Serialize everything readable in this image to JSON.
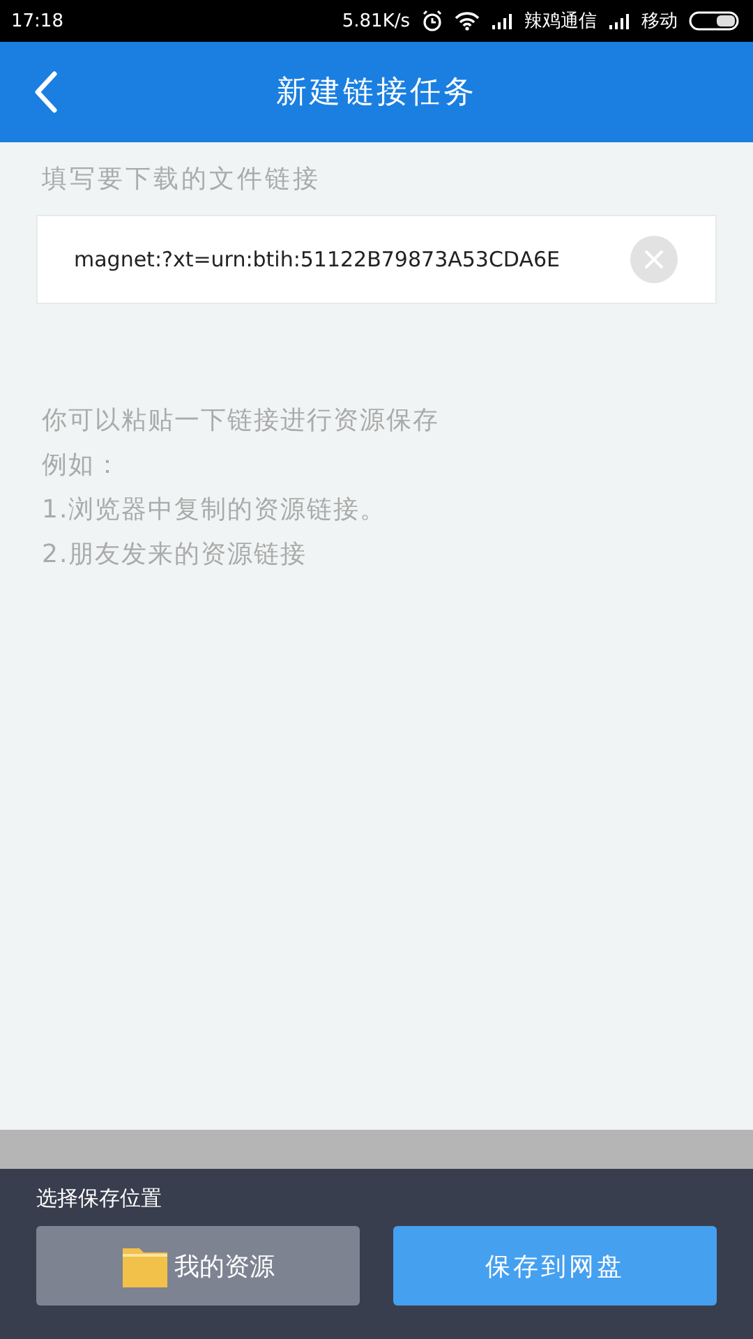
{
  "status_bar": {
    "time": "17:18",
    "speed": "5.81K/s",
    "carrier_1": "辣鸡通信",
    "carrier_2": "移动"
  },
  "header": {
    "title": "新建链接任务"
  },
  "link_field": {
    "label": "填写要下载的文件链接",
    "value": "magnet:?xt=urn:btih:51122B79873A53CDA6E"
  },
  "hints": [
    "你可以粘贴一下链接进行资源保存",
    "例如：",
    "1.浏览器中复制的资源链接。",
    "2.朋友发来的资源链接"
  ],
  "save_panel": {
    "label": "选择保存位置",
    "location_button": "我的资源",
    "save_button": "保存到网盘"
  }
}
